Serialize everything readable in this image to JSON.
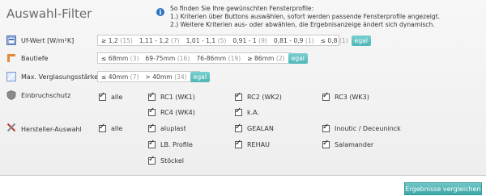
{
  "title": "Auswahl-Filter",
  "info": {
    "line1": "So finden Sie Ihre gewünschten Fensterprofile:",
    "line2": "1.) Kriterien über Buttons auswählen, sofort werden passende Fensterprofile angezeigt.",
    "line3": "2.) Weitere Kriterien aus- oder abwählen, die Ergebnisanzeige ändert sich dynamisch."
  },
  "uf": {
    "label": "Uf-Wert [W/m²K]",
    "options": [
      {
        "label": "≥ 1,2",
        "count": "(15)"
      },
      {
        "label": "1,11 - 1,2",
        "count": "(7)"
      },
      {
        "label": "1,01 - 1,1",
        "count": "(5)"
      },
      {
        "label": "0,91 - 1",
        "count": "(9)"
      },
      {
        "label": "0,81 - 0,9",
        "count": "(1)"
      },
      {
        "label": "≤ 0,8",
        "count": "(1)"
      }
    ],
    "egal": "egal"
  },
  "bautiefe": {
    "label": "Bautiefe",
    "options": [
      {
        "label": "≤ 68mm",
        "count": "(3)"
      },
      {
        "label": "69-75mm",
        "count": "(16)"
      },
      {
        "label": "76-86mm",
        "count": "(19)"
      },
      {
        "label": "≥ 86mm",
        "count": "(2)"
      }
    ],
    "egal": "egal"
  },
  "verglasung": {
    "label": "Max. Verglasungsstärke",
    "options": [
      {
        "label": "≤ 40mm",
        "count": "(7)"
      },
      {
        "label": "> 40mm",
        "count": "(34)"
      }
    ],
    "egal": "egal"
  },
  "einbruchschutz": {
    "label": "Einbruchschutz",
    "all": "alle",
    "items": [
      "RC1 (WK1)",
      "RC2 (WK2)",
      "RC3 (WK3)",
      "RC4 (WK4)",
      "k.A."
    ]
  },
  "hersteller": {
    "label": "Hersteller-Auswahl",
    "all": "alle",
    "items": [
      "aluplast",
      "GEALAN",
      "Inoutic / Deceuninck",
      "LB. Profile",
      "REHAU",
      "Salamander",
      "Stöckel"
    ]
  },
  "compare_button": "Ergebnisse vergleichen",
  "colors": {
    "accent": "#4fb6b7",
    "info": "#2d73c4"
  }
}
